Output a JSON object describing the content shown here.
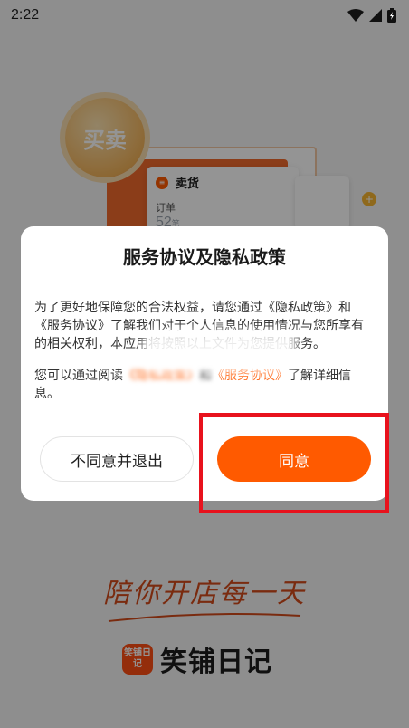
{
  "status_bar": {
    "time": "2:22",
    "icons": [
      "wifi-icon",
      "signal-icon",
      "battery-charging-icon"
    ]
  },
  "background": {
    "coin_text": "买卖",
    "card_title": "卖货",
    "card_sub": "订单",
    "card_number": "52",
    "card_unit": "笔",
    "slogan": "陪你开店每一天",
    "logo_mark_text": "笑铺日记",
    "app_name": "笑铺日记"
  },
  "dialog": {
    "title": "服务协议及隐私政策",
    "paragraph1": "为了更好地保障您的合法权益，请您通过《隐私政策》和《服务协议》了解我们对于个人信息的使用情况与您所享有的相关权利，本应用将按照以上文件为您提供服务。",
    "p2_prefix": "您可以通过阅读",
    "p2_link1": "《隐私政策》",
    "p2_mid": "和",
    "p2_link2": "《服务协议》",
    "p2_suffix": "了解详细信息。",
    "decline_label": "不同意并退出",
    "agree_label": "同意"
  },
  "colors": {
    "accent": "#ff5a00",
    "link": "#ff6a1a",
    "highlight": "#e8121d",
    "slogan": "#d24a1a"
  }
}
